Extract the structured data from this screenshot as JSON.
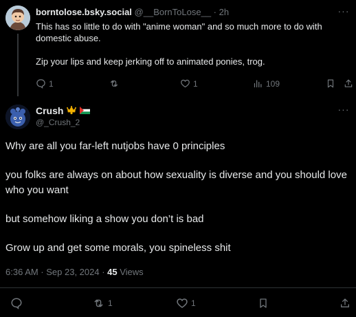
{
  "reply": {
    "display_name": "borntolose.bsky.social",
    "handle": "@__BornToLose__",
    "separator": "·",
    "time": "2h",
    "paragraphs": [
      "This has so little to do with \"anime woman\" and so much more to do with domestic abuse.",
      "Zip your lips and keep jerking off to animated ponies, trog."
    ],
    "actions": {
      "replies": "1",
      "reposts": "",
      "likes": "1",
      "views": "109"
    },
    "avatar_icon": "cartoon-avatar-icon"
  },
  "main": {
    "display_name": "Crush",
    "handle": "@_Crush_2",
    "badges": [
      "crown-emoji",
      "palestine-flag-emoji"
    ],
    "paragraphs": [
      "Why are all you far-left nutjobs have 0 principles",
      "you folks are always on about how sexuality is diverse and you should love who you want",
      "but somehow liking a show you don’t is bad",
      "Grow up and get some morals, you spineless shit"
    ],
    "meta": {
      "timestamp": "6:36 AM · Sep 23, 2024 · ",
      "views_count": "45",
      "views_label": " Views"
    },
    "actions": {
      "replies": "",
      "reposts": "1",
      "likes": "1"
    },
    "avatar_icon": "blue-character-avatar-icon"
  },
  "more_label": "···",
  "colors": {
    "background": "#000000",
    "text": "#e7e9ea",
    "muted": "#71767b",
    "divider": "#2f3336"
  }
}
